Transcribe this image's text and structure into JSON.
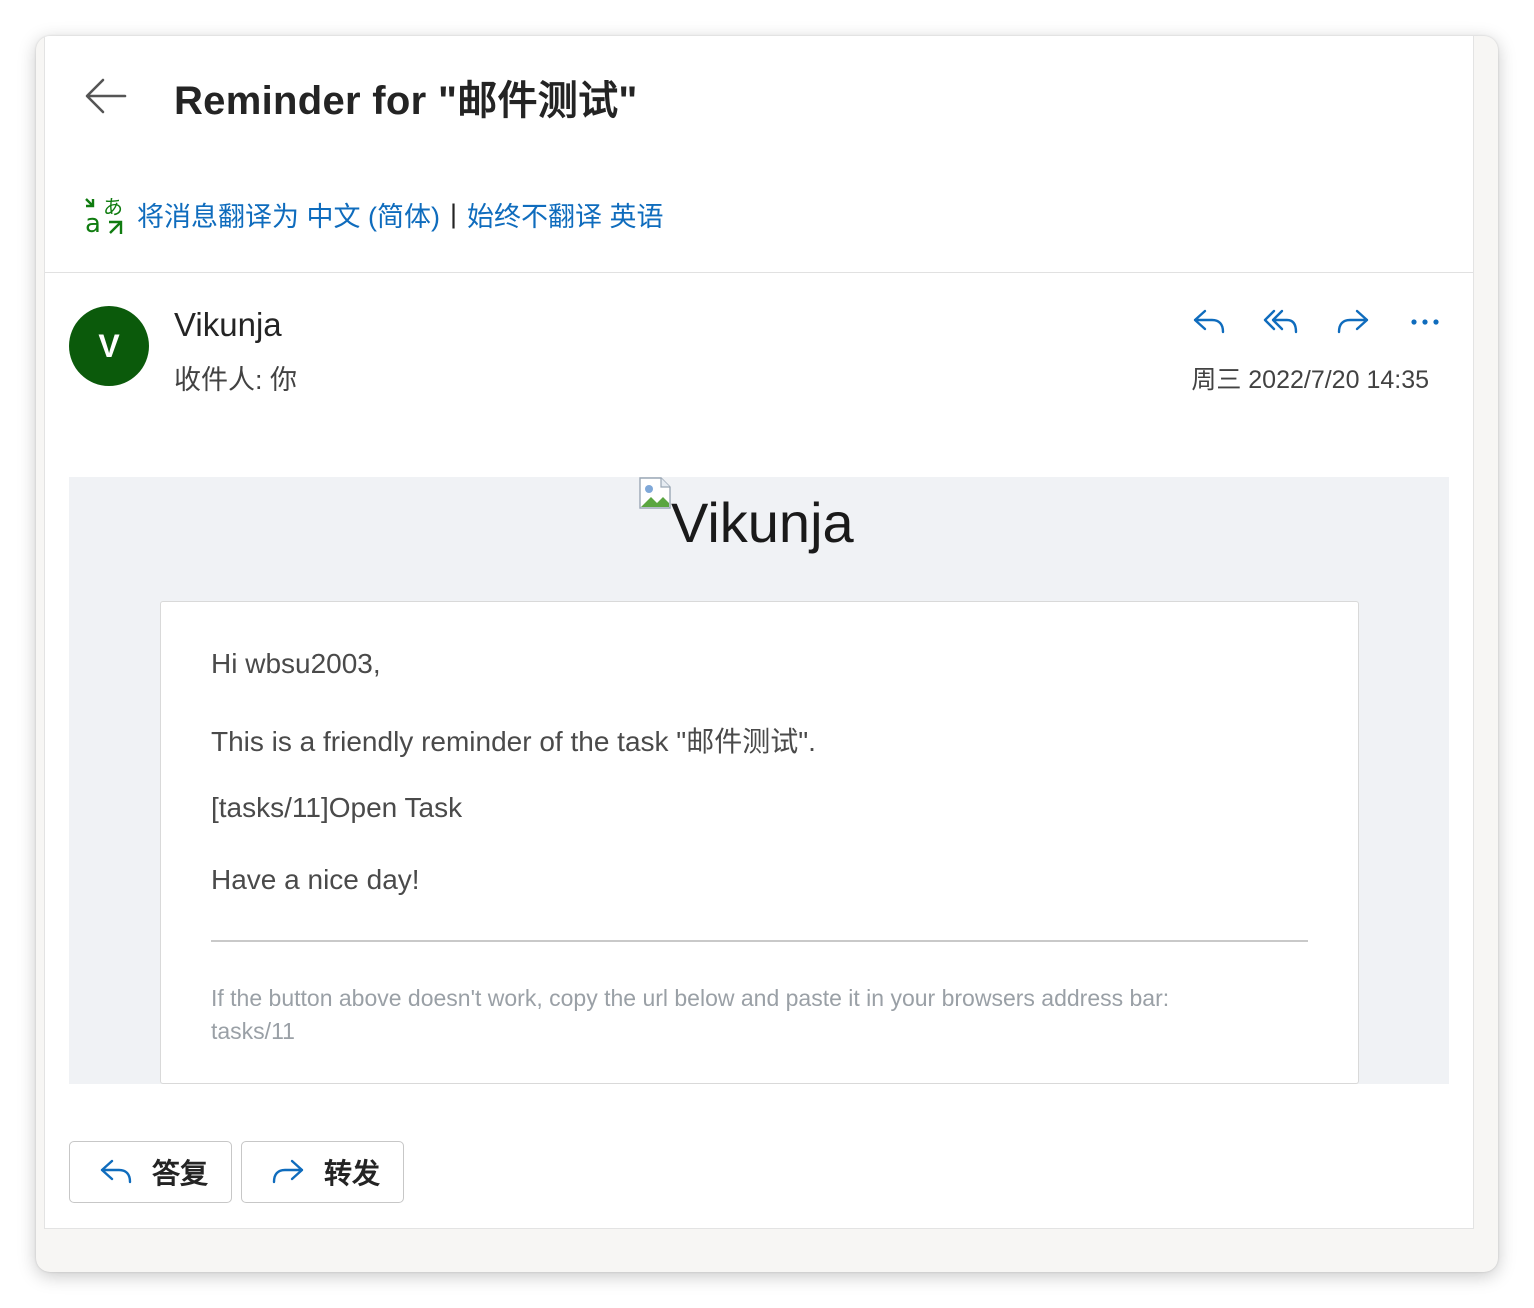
{
  "header": {
    "title": "Reminder for \"邮件测试\""
  },
  "translation": {
    "translate_link": "将消息翻译为 中文 (简体)",
    "separator": "|",
    "never_link": "始终不翻译 英语"
  },
  "sender": {
    "avatar_initial": "V",
    "name": "Vikunja",
    "to_line": "收件人:  你",
    "date": "周三 2022/7/20 14:35"
  },
  "body": {
    "logo_alt": "Vikunja",
    "greeting": "Hi wbsu2003,",
    "reminder": "This is a friendly reminder of the task \"邮件测试\".",
    "task_link": "[tasks/11]Open Task",
    "closing": "Have a nice day!",
    "footer_note": "If the button above doesn't work, copy the url below and paste it in your browsers address bar:",
    "footer_url": "tasks/11"
  },
  "buttons": {
    "reply": "答复",
    "forward": "转发"
  },
  "colors": {
    "accent": "#0f6cbd",
    "avatar": "#0b5a0b",
    "translate_green": "#107c10"
  }
}
